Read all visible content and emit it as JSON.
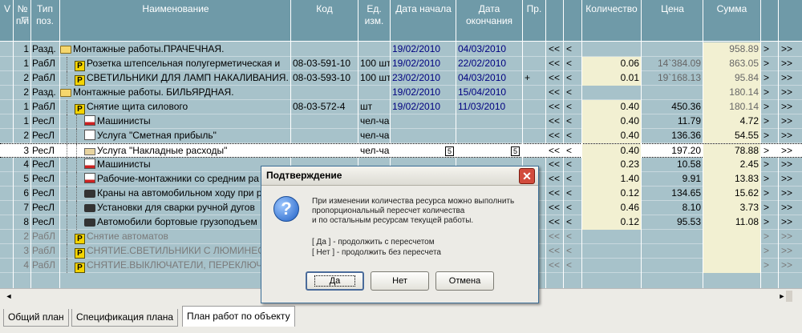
{
  "columns": {
    "v": "V",
    "num": "№ п/п",
    "filter_icon": "▽",
    "type": "Тип поз.",
    "name": "Наименование",
    "code": "Код",
    "unit": "Ед. изм.",
    "start": "Дата начала",
    "end": "Дата окончания",
    "pr": "Пр.",
    "qty": "Количество",
    "price": "Цена",
    "sum": "Сумма"
  },
  "rows": [
    {
      "num": "1",
      "type": "Разд.",
      "icon": "folder",
      "indent": 0,
      "name": "Монтажные работы.ПРАЧЕЧНАЯ.",
      "code": "",
      "unit": "",
      "start": "19/02/2010",
      "end": "04/03/2010",
      "pr": "",
      "nav1": "<<",
      "nav2": "<",
      "qty": "",
      "price": "",
      "sum": "958.89",
      "nav3": ">",
      "nav4": ">>",
      "state": "normal"
    },
    {
      "num": "1",
      "type": "РабЛ",
      "icon": "p",
      "indent": 1,
      "name": "Розетка штепсельная полугерметическая и",
      "code": "08-03-591-10",
      "unit": "100 шт",
      "start": "19/02/2010",
      "end": "22/02/2010",
      "pr": "",
      "nav1": "<<",
      "nav2": "<",
      "qty": "0.06",
      "price": "14`384.09",
      "sum": "863.05",
      "nav3": ">",
      "nav4": ">>",
      "state": "normal"
    },
    {
      "num": "2",
      "type": "РабЛ",
      "icon": "p",
      "indent": 1,
      "name": "СВЕТИЛЬНИКИ ДЛЯ ЛАМП НАКАЛИВАНИЯ. С",
      "code": "08-03-593-10",
      "unit": "100 шт",
      "start": "23/02/2010",
      "end": "04/03/2010",
      "pr": "+",
      "nav1": "<<",
      "nav2": "<",
      "qty": "0.01",
      "price": "19`168.13",
      "sum": "95.84",
      "nav3": ">",
      "nav4": ">>",
      "state": "normal"
    },
    {
      "num": "2",
      "type": "Разд.",
      "icon": "folder",
      "indent": 0,
      "name": "Монтажные работы. БИЛЬЯРДНАЯ.",
      "code": "",
      "unit": "",
      "start": "19/02/2010",
      "end": "15/04/2010",
      "pr": "",
      "nav1": "<<",
      "nav2": "<",
      "qty": "",
      "price": "",
      "sum": "180.14",
      "nav3": ">",
      "nav4": ">>",
      "state": "normal"
    },
    {
      "num": "1",
      "type": "РабЛ",
      "icon": "p",
      "indent": 1,
      "name": "Снятие  щита силового",
      "code": "08-03-572-4",
      "unit": "шт",
      "start": "19/02/2010",
      "end": "11/03/2010",
      "pr": "",
      "nav1": "<<",
      "nav2": "<",
      "qty": "0.40",
      "price": "450.36",
      "sum": "180.14",
      "nav3": ">",
      "nav4": ">>",
      "state": "normal"
    },
    {
      "num": "1",
      "type": "РесЛ",
      "icon": "chart",
      "indent": 2,
      "name": "Машинисты",
      "code": "",
      "unit": "чел-час",
      "start": "",
      "end": "",
      "pr": "",
      "nav1": "<<",
      "nav2": "<",
      "qty": "0.40",
      "price": "11.79",
      "sum": "4.72",
      "nav3": ">",
      "nav4": ">>",
      "state": "normal"
    },
    {
      "num": "2",
      "type": "РесЛ",
      "icon": "serv",
      "indent": 2,
      "name": "Услуга \"Сметная прибыль\"",
      "code": "",
      "unit": "чел-час",
      "start": "",
      "end": "",
      "pr": "",
      "nav1": "<<",
      "nav2": "<",
      "qty": "0.40",
      "price": "136.36",
      "sum": "54.55",
      "nav3": ">",
      "nav4": ">>",
      "state": "normal"
    },
    {
      "num": "3",
      "type": "РесЛ",
      "icon": "hand",
      "indent": 2,
      "name": "Услуга \"Накладные расходы\"",
      "code": "",
      "unit": "чел-час",
      "start": "",
      "end": "",
      "pr": "",
      "nav1": "<<",
      "nav2": "<",
      "qty": "0.40",
      "price": "197.20",
      "sum": "78.88",
      "nav3": ">",
      "nav4": ">>",
      "state": "selected"
    },
    {
      "num": "4",
      "type": "РесЛ",
      "icon": "chart",
      "indent": 2,
      "name": "Машинисты",
      "code": "",
      "unit": "",
      "start": "",
      "end": "",
      "pr": "",
      "nav1": "<<",
      "nav2": "<",
      "qty": "0.23",
      "price": "10.58",
      "sum": "2.45",
      "nav3": ">",
      "nav4": ">>",
      "state": "normal"
    },
    {
      "num": "5",
      "type": "РесЛ",
      "icon": "chart",
      "indent": 2,
      "name": "Рабочие-монтажники со средним ра",
      "code": "",
      "unit": "",
      "start": "",
      "end": "",
      "pr": "",
      "nav1": "<<",
      "nav2": "<",
      "qty": "1.40",
      "price": "9.91",
      "sum": "13.83",
      "nav3": ">",
      "nav4": ">>",
      "state": "normal"
    },
    {
      "num": "6",
      "type": "РесЛ",
      "icon": "crane",
      "indent": 2,
      "name": "Краны на автомобильном ходу при р",
      "code": "",
      "unit": "",
      "start": "",
      "end": "",
      "pr": "",
      "nav1": "<<",
      "nav2": "<",
      "qty": "0.12",
      "price": "134.65",
      "sum": "15.62",
      "nav3": ">",
      "nav4": ">>",
      "state": "normal"
    },
    {
      "num": "7",
      "type": "РесЛ",
      "icon": "crane",
      "indent": 2,
      "name": "Установки для сварки ручной дугов",
      "code": "",
      "unit": "",
      "start": "",
      "end": "",
      "pr": "",
      "nav1": "<<",
      "nav2": "<",
      "qty": "0.46",
      "price": "8.10",
      "sum": "3.73",
      "nav3": ">",
      "nav4": ">>",
      "state": "normal"
    },
    {
      "num": "8",
      "type": "РесЛ",
      "icon": "crane",
      "indent": 2,
      "name": "Автомобили бортовые грузоподъем",
      "code": "",
      "unit": "",
      "start": "",
      "end": "",
      "pr": "",
      "nav1": "<<",
      "nav2": "<",
      "qty": "0.12",
      "price": "95.53",
      "sum": "11.08",
      "nav3": ">",
      "nav4": ">>",
      "state": "normal"
    },
    {
      "num": "2",
      "type": "РабЛ",
      "icon": "p",
      "indent": 1,
      "name": "Снятие автоматов",
      "code": "",
      "unit": "",
      "start": "",
      "end": "",
      "pr": "",
      "nav1": "<<",
      "nav2": "<",
      "qty": "",
      "price": "",
      "sum": "",
      "nav3": ">",
      "nav4": ">>",
      "state": "gray"
    },
    {
      "num": "3",
      "type": "РабЛ",
      "icon": "p",
      "indent": 1,
      "name": "СНЯТИЕ.СВЕТИЛЬНИКИ С ЛЮМИНЕСЦ",
      "code": "",
      "unit": "",
      "start": "",
      "end": "",
      "pr": "",
      "nav1": "<<",
      "nav2": "<",
      "qty": "",
      "price": "",
      "sum": "",
      "nav3": ">",
      "nav4": ">>",
      "state": "gray"
    },
    {
      "num": "4",
      "type": "РабЛ",
      "icon": "p",
      "indent": 1,
      "name": "СНЯТИЕ.ВЫКЛЮЧАТЕЛИ, ПЕРЕКЛЮЧА",
      "code": "",
      "unit": "",
      "start": "",
      "end": "",
      "pr": "",
      "nav1": "<<",
      "nav2": "<",
      "qty": "",
      "price": "",
      "sum": "",
      "nav3": ">",
      "nav4": ">>",
      "state": "gray"
    }
  ],
  "date_button_label": "5",
  "p_icon_letter": "P",
  "scroll": {
    "left": "◄",
    "right": "►"
  },
  "tabs": [
    {
      "label": "Общий план",
      "active": false
    },
    {
      "label": "Спецификация плана",
      "active": false
    },
    {
      "label": "План работ по объекту",
      "active": true
    }
  ],
  "dialog": {
    "title": "Подтверждение",
    "close": "✕",
    "icon": "?",
    "message_lines": [
      "При изменении количества ресурса можно выполнить",
      "пропорциональный пересчет количества",
      "и по остальным ресурсам текущей работы."
    ],
    "option_yes": "[ Да  ]  - продолжить с пересчетом",
    "option_no": "[ Нет ]  - продолжить без пересчета",
    "btn_yes": "Да",
    "btn_no": "Нет",
    "btn_cancel": "Отмена"
  },
  "colors": {
    "header": "#6f9aa8",
    "grid": "#a7c2ca",
    "accent": "#f2f0d2"
  }
}
